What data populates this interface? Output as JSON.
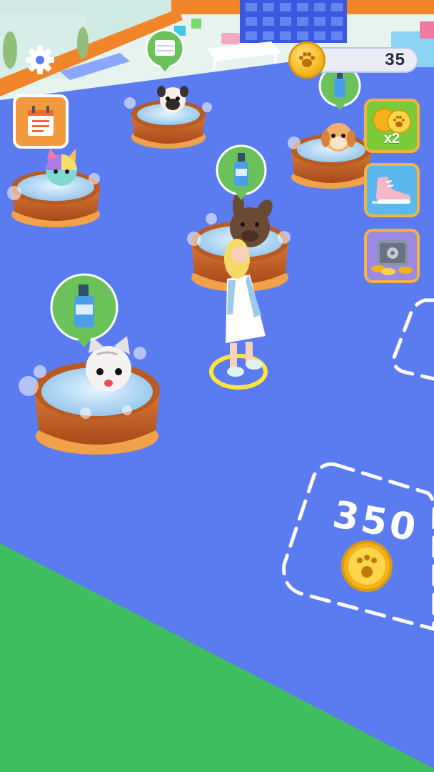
{
  "hud": {
    "coins": "35",
    "boost_multiplier": "x2",
    "buy_zone_price": "350"
  },
  "icons": {
    "settings": "gear-icon",
    "tasks": "calendar-notepad-icon",
    "coin": "paw-coin-icon",
    "double_coins": "double-coins-icon",
    "speed": "sneaker-icon",
    "vault": "safe-icon",
    "request": "body-wash-bottle-icon"
  },
  "colors": {
    "floor": "#5b7cf0",
    "grass": "#3fbf5f",
    "accent_orange": "#f6b23a",
    "bubble_green": "#6cc25a",
    "tub_wood": "#c8652a"
  }
}
